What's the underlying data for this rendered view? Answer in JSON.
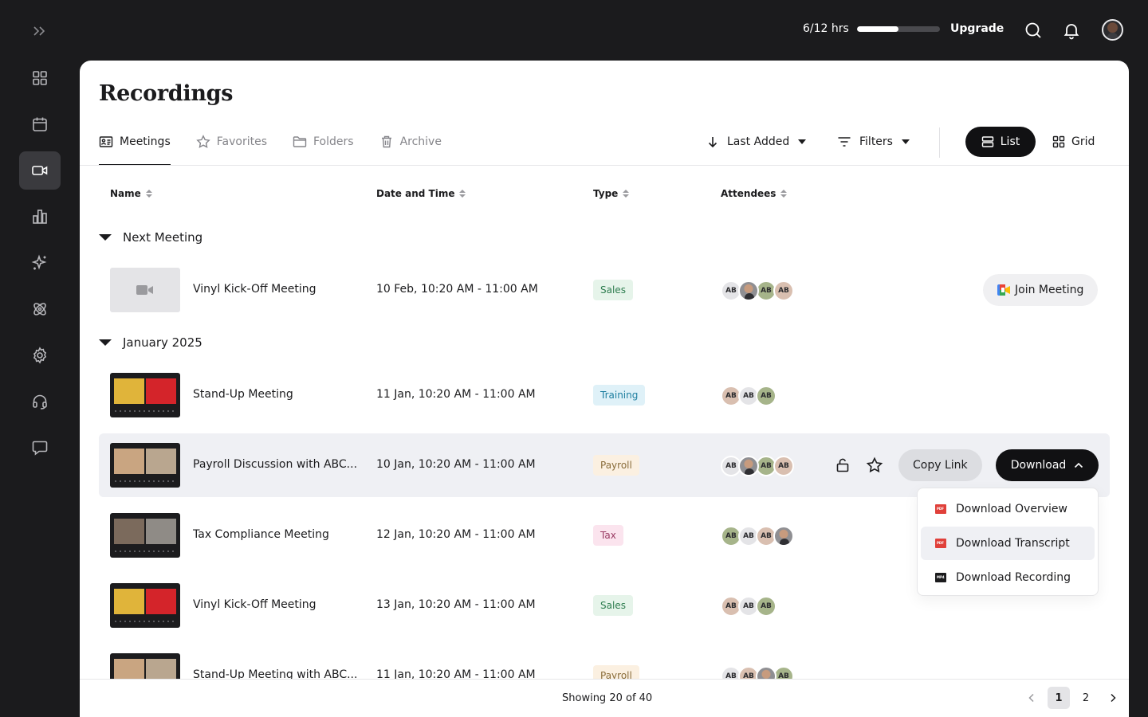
{
  "topbar": {
    "usage_text": "6/12 hrs",
    "usage_fraction": 0.5,
    "upgrade_label": "Upgrade"
  },
  "sidebar": {
    "items": [
      {
        "name": "dashboard",
        "icon": "grid-icon",
        "active": false
      },
      {
        "name": "calendar",
        "icon": "calendar-icon",
        "active": false
      },
      {
        "name": "recordings",
        "icon": "video-camera-icon",
        "active": true
      },
      {
        "name": "analytics",
        "icon": "bar-chart-icon",
        "active": false
      },
      {
        "name": "ai-assistant",
        "icon": "sparkles-icon",
        "active": false
      },
      {
        "name": "integrations",
        "icon": "atom-icon",
        "active": false
      },
      {
        "name": "settings",
        "icon": "gear-icon",
        "active": false
      },
      {
        "name": "support",
        "icon": "headset-icon",
        "active": false
      },
      {
        "name": "messages",
        "icon": "chat-icon",
        "active": false
      }
    ]
  },
  "page": {
    "title": "Recordings",
    "tabs": [
      {
        "label": "Meetings",
        "active": true
      },
      {
        "label": "Favorites",
        "active": false
      },
      {
        "label": "Folders",
        "active": false
      },
      {
        "label": "Archive",
        "active": false
      }
    ],
    "sort_label": "Last Added",
    "filters_label": "Filters",
    "view_list_label": "List",
    "view_grid_label": "Grid"
  },
  "table": {
    "columns": [
      "Name",
      "Date and Time",
      "Type",
      "Attendees"
    ],
    "groups": [
      {
        "label": "Next Meeting"
      },
      {
        "label": "January 2025"
      }
    ],
    "rows": [
      {
        "name": "Vinyl Kick-Off Meeting",
        "date": "10 Feb, 10:20 AM - 11:00 AM",
        "type": "Sales"
      },
      {
        "name": "Stand-Up Meeting",
        "date": "11 Jan, 10:20 AM - 11:00 AM",
        "type": "Training"
      },
      {
        "name": "Payroll Discussion with ABC...",
        "date": "10 Jan, 10:20 AM - 11:00 AM",
        "type": "Payroll"
      },
      {
        "name": "Tax Compliance Meeting",
        "date": "12 Jan, 10:20 AM - 11:00 AM",
        "type": "Tax"
      },
      {
        "name": "Vinyl Kick-Off Meeting",
        "date": "13 Jan, 10:20 AM - 11:00 AM",
        "type": "Sales"
      },
      {
        "name": "Stand-Up Meeting with ABC...",
        "date": "11 Jan, 10:20 AM - 11:00 AM",
        "type": "Payroll"
      }
    ],
    "attendee_initials": "AB"
  },
  "actions": {
    "join_meeting_label": "Join Meeting",
    "copy_link_label": "Copy Link",
    "download_label": "Download"
  },
  "download_menu": {
    "items": [
      {
        "label": "Download Overview",
        "file_type": "PDF"
      },
      {
        "label": "Download Transcript",
        "file_type": "PDF"
      },
      {
        "label": "Download Recording",
        "file_type": "MP4"
      }
    ]
  },
  "footer": {
    "showing_text": "Showing 20 of 40",
    "pages": [
      "1",
      "2"
    ],
    "current_page": "1"
  },
  "colors": {
    "badge_sales_bg": "#e6f4ea",
    "badge_sales_fg": "#2e7d4f",
    "badge_training_bg": "#dff1f8",
    "badge_training_fg": "#1f7fa0",
    "badge_payroll_bg": "#fbf0e1",
    "badge_payroll_fg": "#8a6d3b",
    "badge_tax_bg": "#fbe4ee",
    "badge_tax_fg": "#9a3b63",
    "pdf_red": "#e0403a",
    "accent_dark": "#111113"
  }
}
